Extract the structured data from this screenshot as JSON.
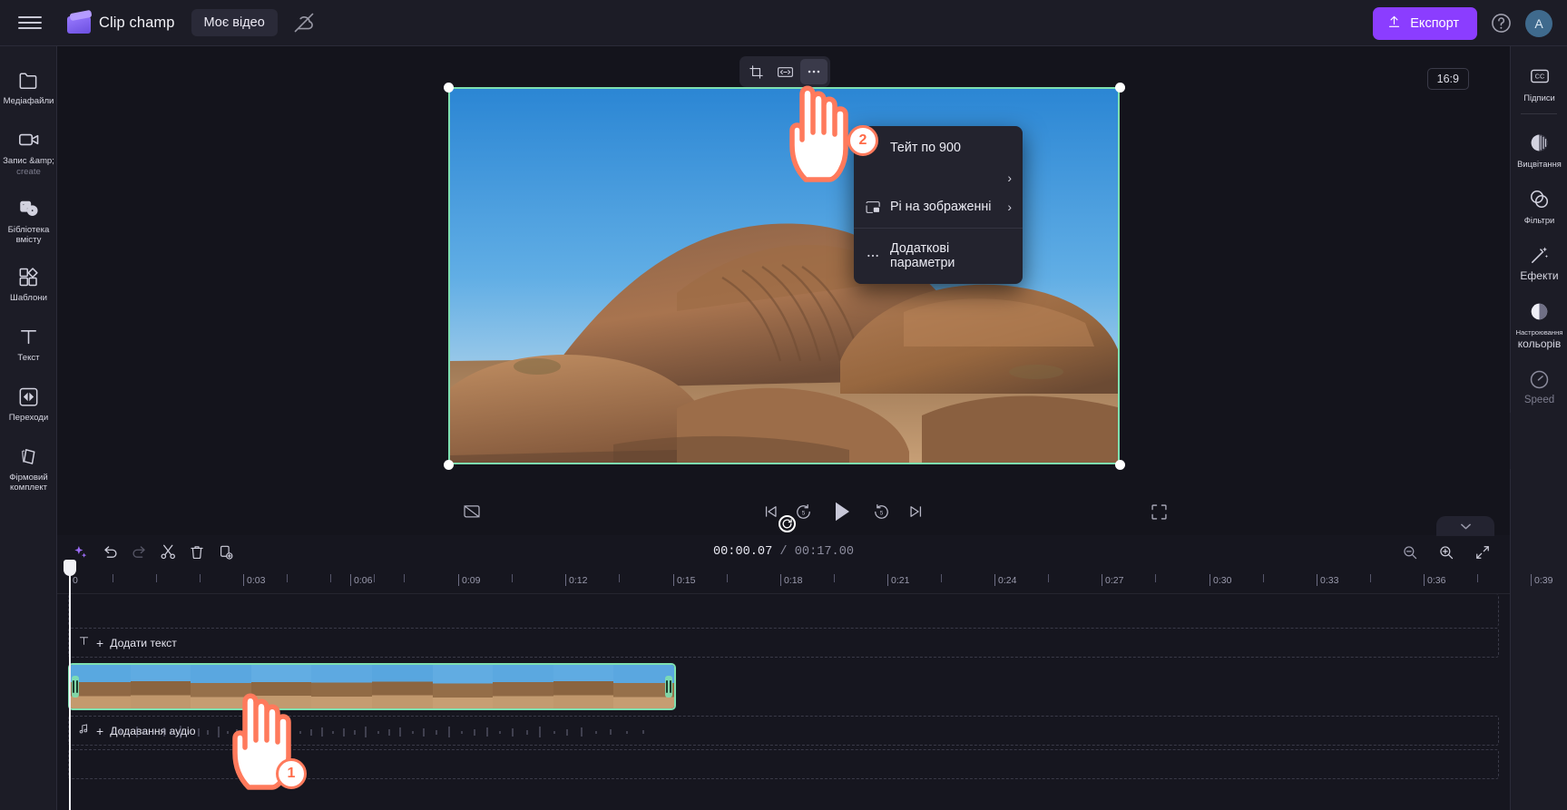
{
  "topbar": {
    "menu_icon": "hamburger-icon",
    "brand": "Clip champ",
    "project_tab": "Моє відео",
    "cloud_icon": "cloud-off-icon",
    "export_label": "Експорт",
    "help_icon": "help-icon",
    "avatar_initial": "A"
  },
  "left_rail": [
    {
      "icon": "folder-icon",
      "label": "Медіафайли",
      "dim": false
    },
    {
      "icon": "video-camera-icon",
      "label": "Запис &amp;",
      "label2": "create",
      "dim": false
    },
    {
      "icon": "content-library-icon",
      "label": "Бібліотека вмісту",
      "dim": false
    },
    {
      "icon": "templates-icon",
      "label": "Шаблони",
      "dim": false
    },
    {
      "icon": "text-icon",
      "label": "Текст",
      "dim": false
    },
    {
      "icon": "transitions-icon",
      "label": "Переходи",
      "dim": false
    },
    {
      "icon": "brand-kit-icon",
      "label": "Фірмовий комплект",
      "dim": false
    }
  ],
  "right_rail": [
    {
      "icon": "closed-captions-icon",
      "label": "Підписи",
      "dim": false
    },
    {
      "icon": "fade-icon",
      "label": "Вицвітання",
      "dim": false
    },
    {
      "icon": "filters-icon",
      "label": "Фільтри",
      "dim": false
    },
    {
      "icon": "effects-wand-icon",
      "label": "Ефекти",
      "dim": false
    },
    {
      "icon": "color-adjust-icon",
      "label": "Настроювання",
      "label2": "кольорів",
      "dim": false
    },
    {
      "icon": "speed-gauge-icon",
      "label": "Speed",
      "dim": true
    }
  ],
  "stage": {
    "ratio_badge": "16:9",
    "float_toolbar": [
      {
        "icon": "crop-icon",
        "active": false
      },
      {
        "icon": "fit-width-icon",
        "active": false
      },
      {
        "icon": "more-options-icon",
        "active": true
      }
    ],
    "rotate_handle_icon": "rotate-icon"
  },
  "context_menu": {
    "items": [
      {
        "icon": "",
        "label": "Тейт по 900",
        "chevron": ""
      },
      {
        "icon": "",
        "label": "",
        "chevron": "›"
      },
      {
        "icon": "picture-in-picture-icon",
        "label": "Pі на зображенні",
        "chevron": "›"
      },
      {
        "icon": "more-dots-icon",
        "label": "Додаткові параметри",
        "chevron": ""
      }
    ]
  },
  "playback": {
    "captions_off_icon": "captions-off-icon",
    "skip_start_icon": "skip-to-start-icon",
    "rewind_icon": "rewind-5-icon",
    "play_icon": "play-icon",
    "forward_icon": "forward-5-icon",
    "skip_end_icon": "skip-to-end-icon",
    "fullscreen_icon": "fullscreen-icon"
  },
  "timeline": {
    "toolbar": [
      {
        "icon": "ai-sparkle-icon",
        "dim": false
      },
      {
        "icon": "undo-icon",
        "dim": false
      },
      {
        "icon": "redo-icon",
        "dim": true
      },
      {
        "icon": "split-scissors-icon",
        "dim": false
      },
      {
        "icon": "delete-trash-icon",
        "dim": false
      },
      {
        "icon": "duplicate-icon",
        "dim": false
      }
    ],
    "current_time": "00:00.07",
    "separator": "/",
    "total_time": "00:17.00",
    "zoom_controls": [
      {
        "icon": "zoom-out-icon"
      },
      {
        "icon": "zoom-in-icon"
      },
      {
        "icon": "fit-timeline-icon"
      }
    ],
    "ruler_labels": [
      "0",
      "0:03",
      "0:06",
      "0:09",
      "0:12",
      "0:15",
      "0:18",
      "0:21",
      "0:24",
      "0:27",
      "0:30",
      "0:33",
      "0:36",
      "0:39"
    ],
    "text_track": {
      "icon": "text-track-icon",
      "plus": "+",
      "label": "Додати текст"
    },
    "audio_track": {
      "icon": "audio-track-icon",
      "plus": "+",
      "label": "Додавання аудіо"
    },
    "collapse_icon": "chevron-down-icon"
  },
  "annotations": [
    {
      "badge": "1",
      "target": "video-clip-on-timeline"
    },
    {
      "badge": "2",
      "target": "context-menu-more-options"
    }
  ],
  "colors": {
    "accent_purple": "#8b3dff",
    "selection_green": "#7ee0b0",
    "pointer_orange": "#ff7a5c",
    "panel_bg": "#1c1c26",
    "app_bg": "#14141c"
  }
}
